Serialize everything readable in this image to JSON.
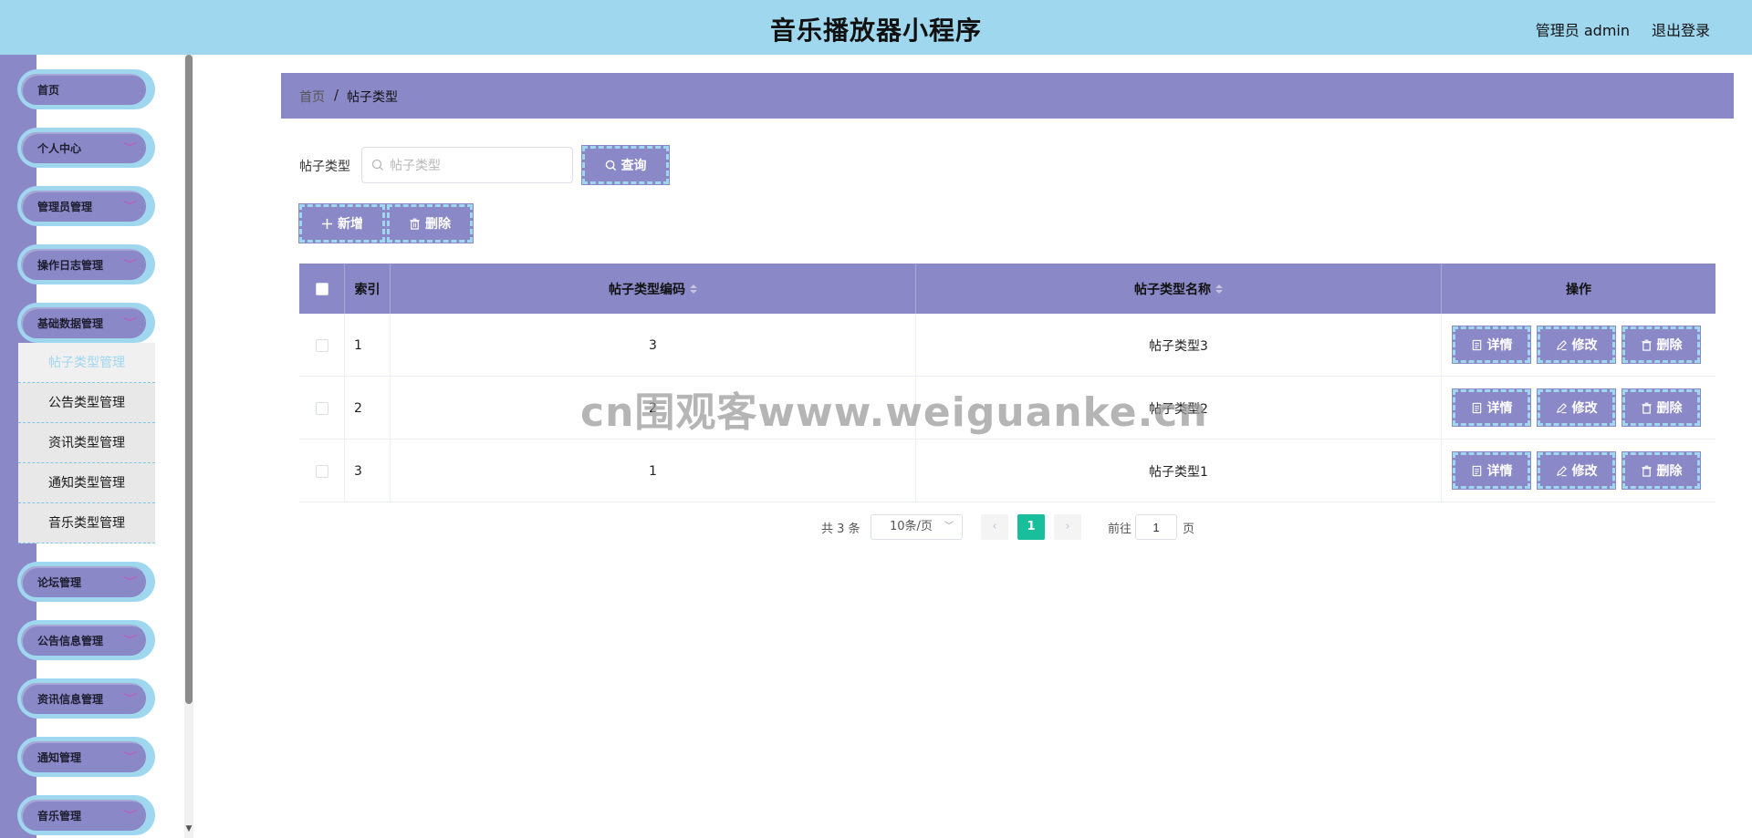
{
  "header": {
    "title": "音乐播放器小程序",
    "user": "管理员 admin",
    "logout": "退出登录"
  },
  "sidebar": {
    "items": [
      {
        "label": "首页",
        "has_arrow": false
      },
      {
        "label": "个人中心",
        "has_arrow": true
      },
      {
        "label": "管理员管理",
        "has_arrow": true
      },
      {
        "label": "操作日志管理",
        "has_arrow": true
      },
      {
        "label": "基础数据管理",
        "has_arrow": true
      },
      {
        "label": "论坛管理",
        "has_arrow": true
      },
      {
        "label": "公告信息管理",
        "has_arrow": true
      },
      {
        "label": "资讯信息管理",
        "has_arrow": true
      },
      {
        "label": "通知管理",
        "has_arrow": true
      },
      {
        "label": "音乐管理",
        "has_arrow": true
      }
    ],
    "submenu": [
      {
        "label": "帖子类型管理",
        "active": true
      },
      {
        "label": "公告类型管理",
        "active": false
      },
      {
        "label": "资讯类型管理",
        "active": false
      },
      {
        "label": "通知类型管理",
        "active": false
      },
      {
        "label": "音乐类型管理",
        "active": false
      }
    ]
  },
  "breadcrumb": {
    "home": "首页",
    "separator": "/",
    "current": "帖子类型"
  },
  "filter": {
    "label": "帖子类型",
    "placeholder": "帖子类型",
    "value": ""
  },
  "buttons": {
    "query": "查询",
    "add": "新增",
    "delete": "删除"
  },
  "table": {
    "columns": {
      "index": "索引",
      "code": "帖子类型编码",
      "name": "帖子类型名称",
      "actions": "操作"
    },
    "rows": [
      {
        "index": "1",
        "code": "3",
        "name": "帖子类型3"
      },
      {
        "index": "2",
        "code": "2",
        "name": "帖子类型2"
      },
      {
        "index": "3",
        "code": "1",
        "name": "帖子类型1"
      }
    ],
    "row_actions": {
      "detail": "详情",
      "edit": "修改",
      "delete": "删除"
    }
  },
  "pagination": {
    "total": "共 3 条",
    "page_size": "10条/页",
    "current_page": "1",
    "goto_label": "前往",
    "goto_value": "1",
    "page_suffix": "页"
  },
  "watermark": "cn围观客www.weiguanke.cn",
  "colors": {
    "header_bg": "#9fd7ef",
    "accent": "#8a88c6",
    "page_active": "#19be9b",
    "dashed_border": "#9fd7ef"
  }
}
